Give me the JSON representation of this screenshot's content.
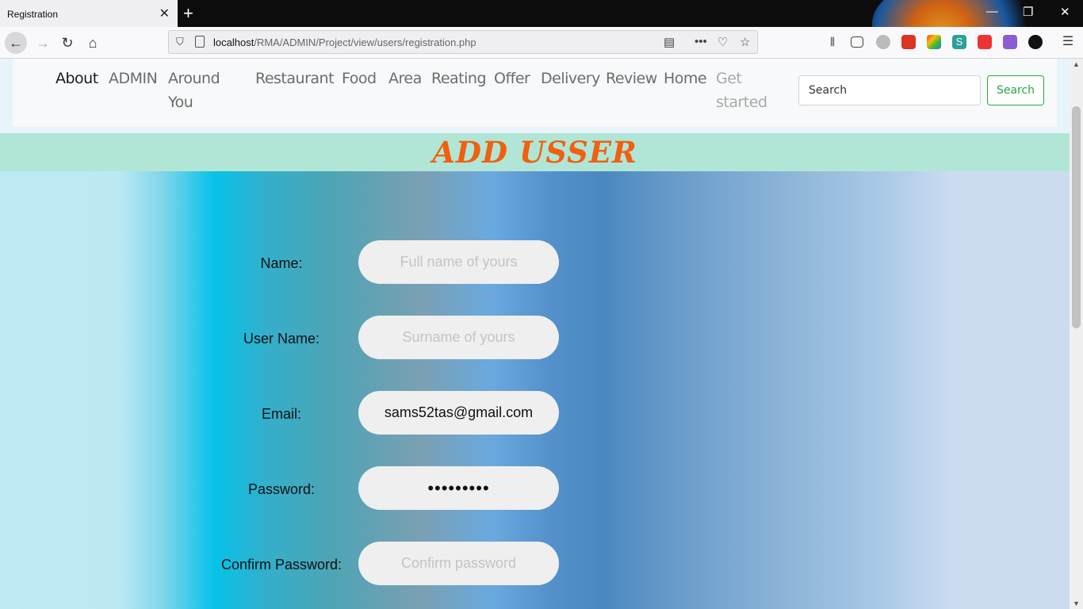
{
  "browser": {
    "tab_title": "Registration",
    "url_host": "localhost",
    "url_path": "/RMA/ADMIN/Project/view/users/registration.php"
  },
  "nav": {
    "links": [
      "About",
      "ADMIN",
      "Around You",
      "Restaurant",
      "Food",
      "Area",
      "Reating",
      "Offer",
      "Delivery",
      "Review",
      "Home",
      "Get started"
    ],
    "search_placeholder": "Search",
    "search_button": "Search"
  },
  "page": {
    "title": "ADD USSER"
  },
  "form": {
    "name_label": "Name:",
    "name_placeholder": "Full name of yours",
    "username_label": "User Name:",
    "username_placeholder": "Surname of yours",
    "email_label": "Email:",
    "email_value": "sams52tas@gmail.com",
    "password_label": "Password:",
    "password_value": "123456789",
    "confirm_label": "Confirm Password:",
    "confirm_placeholder": "Confirm password"
  },
  "colors": {
    "title": "#f06010",
    "title_band": "#b1e6d6",
    "search_button": "#28a745"
  }
}
